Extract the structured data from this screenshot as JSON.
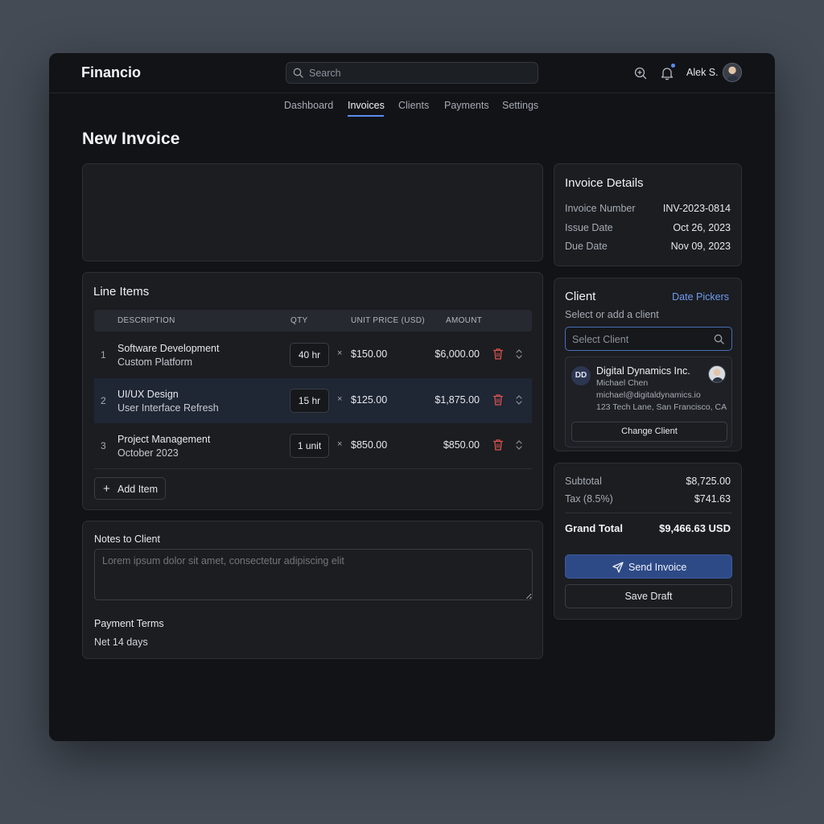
{
  "app": {
    "brand": "Financio"
  },
  "header": {
    "search_placeholder": "Search",
    "user_name": "Alek S."
  },
  "nav": {
    "items": [
      {
        "label": "Dashboard"
      },
      {
        "label": "Invoices",
        "active": true
      },
      {
        "label": "Clients"
      },
      {
        "label": "Payments"
      },
      {
        "label": "Settings"
      }
    ]
  },
  "page": {
    "title": "New Invoice"
  },
  "line_items": {
    "title": "Line Items",
    "columns": [
      "DESCRIPTION",
      "QTY",
      "UNIT PRICE (USD)",
      "AMOUNT"
    ],
    "rows": [
      {
        "num": "1",
        "desc1": "Software Development",
        "desc2": "Custom Platform",
        "qty": "40 hr",
        "times": "×",
        "price": "$150.00",
        "amount": "$6,000.00"
      },
      {
        "num": "2",
        "desc1": "UI/UX Design",
        "desc2": "User Interface Refresh",
        "qty": "15 hr",
        "times": "×",
        "price": "$125.00",
        "amount": "$1,875.00"
      },
      {
        "num": "3",
        "desc1": "Project Management",
        "desc2": "October 2023",
        "qty": "1 unit",
        "times": "×",
        "price": "$850.00",
        "amount": "$850.00"
      }
    ],
    "add_label": "Add Item"
  },
  "notes": {
    "label": "Notes to Client",
    "placeholder": "Lorem ipsum dolor sit amet, consectetur adipiscing elit",
    "terms_label": "Payment Terms",
    "terms_value": "Net 14 days"
  },
  "invoice_details": {
    "title": "Invoice Details",
    "fields": [
      {
        "key": "Invoice Number",
        "value": "INV-2023-0814"
      },
      {
        "key": "Issue Date",
        "value": "Oct 26, 2023"
      },
      {
        "key": "Due Date",
        "value": "Nov 09, 2023"
      }
    ]
  },
  "client": {
    "title": "Client",
    "link": "Date Pickers",
    "subtitle": "Select or add a client",
    "search_placeholder": "Select Client",
    "initials": "DD",
    "company": "Digital Dynamics Inc.",
    "contact": "Michael Chen",
    "email": "michael@digitaldynamics.io",
    "address": "123 Tech Lane, San Francisco, CA",
    "change_label": "Change Client"
  },
  "totals": {
    "subtotal_label": "Subtotal",
    "subtotal_value": "$8,725.00",
    "tax_label": "Tax (8.5%)",
    "tax_value": "$741.63",
    "grand_label": "Grand Total",
    "grand_value": "$9,466.63 USD",
    "send_label": "Send Invoice",
    "draft_label": "Save Draft"
  },
  "colors": {
    "accent": "#5b8dee",
    "primary_button": "#2e4a86",
    "danger": "#d9534f",
    "background": "#111317"
  }
}
